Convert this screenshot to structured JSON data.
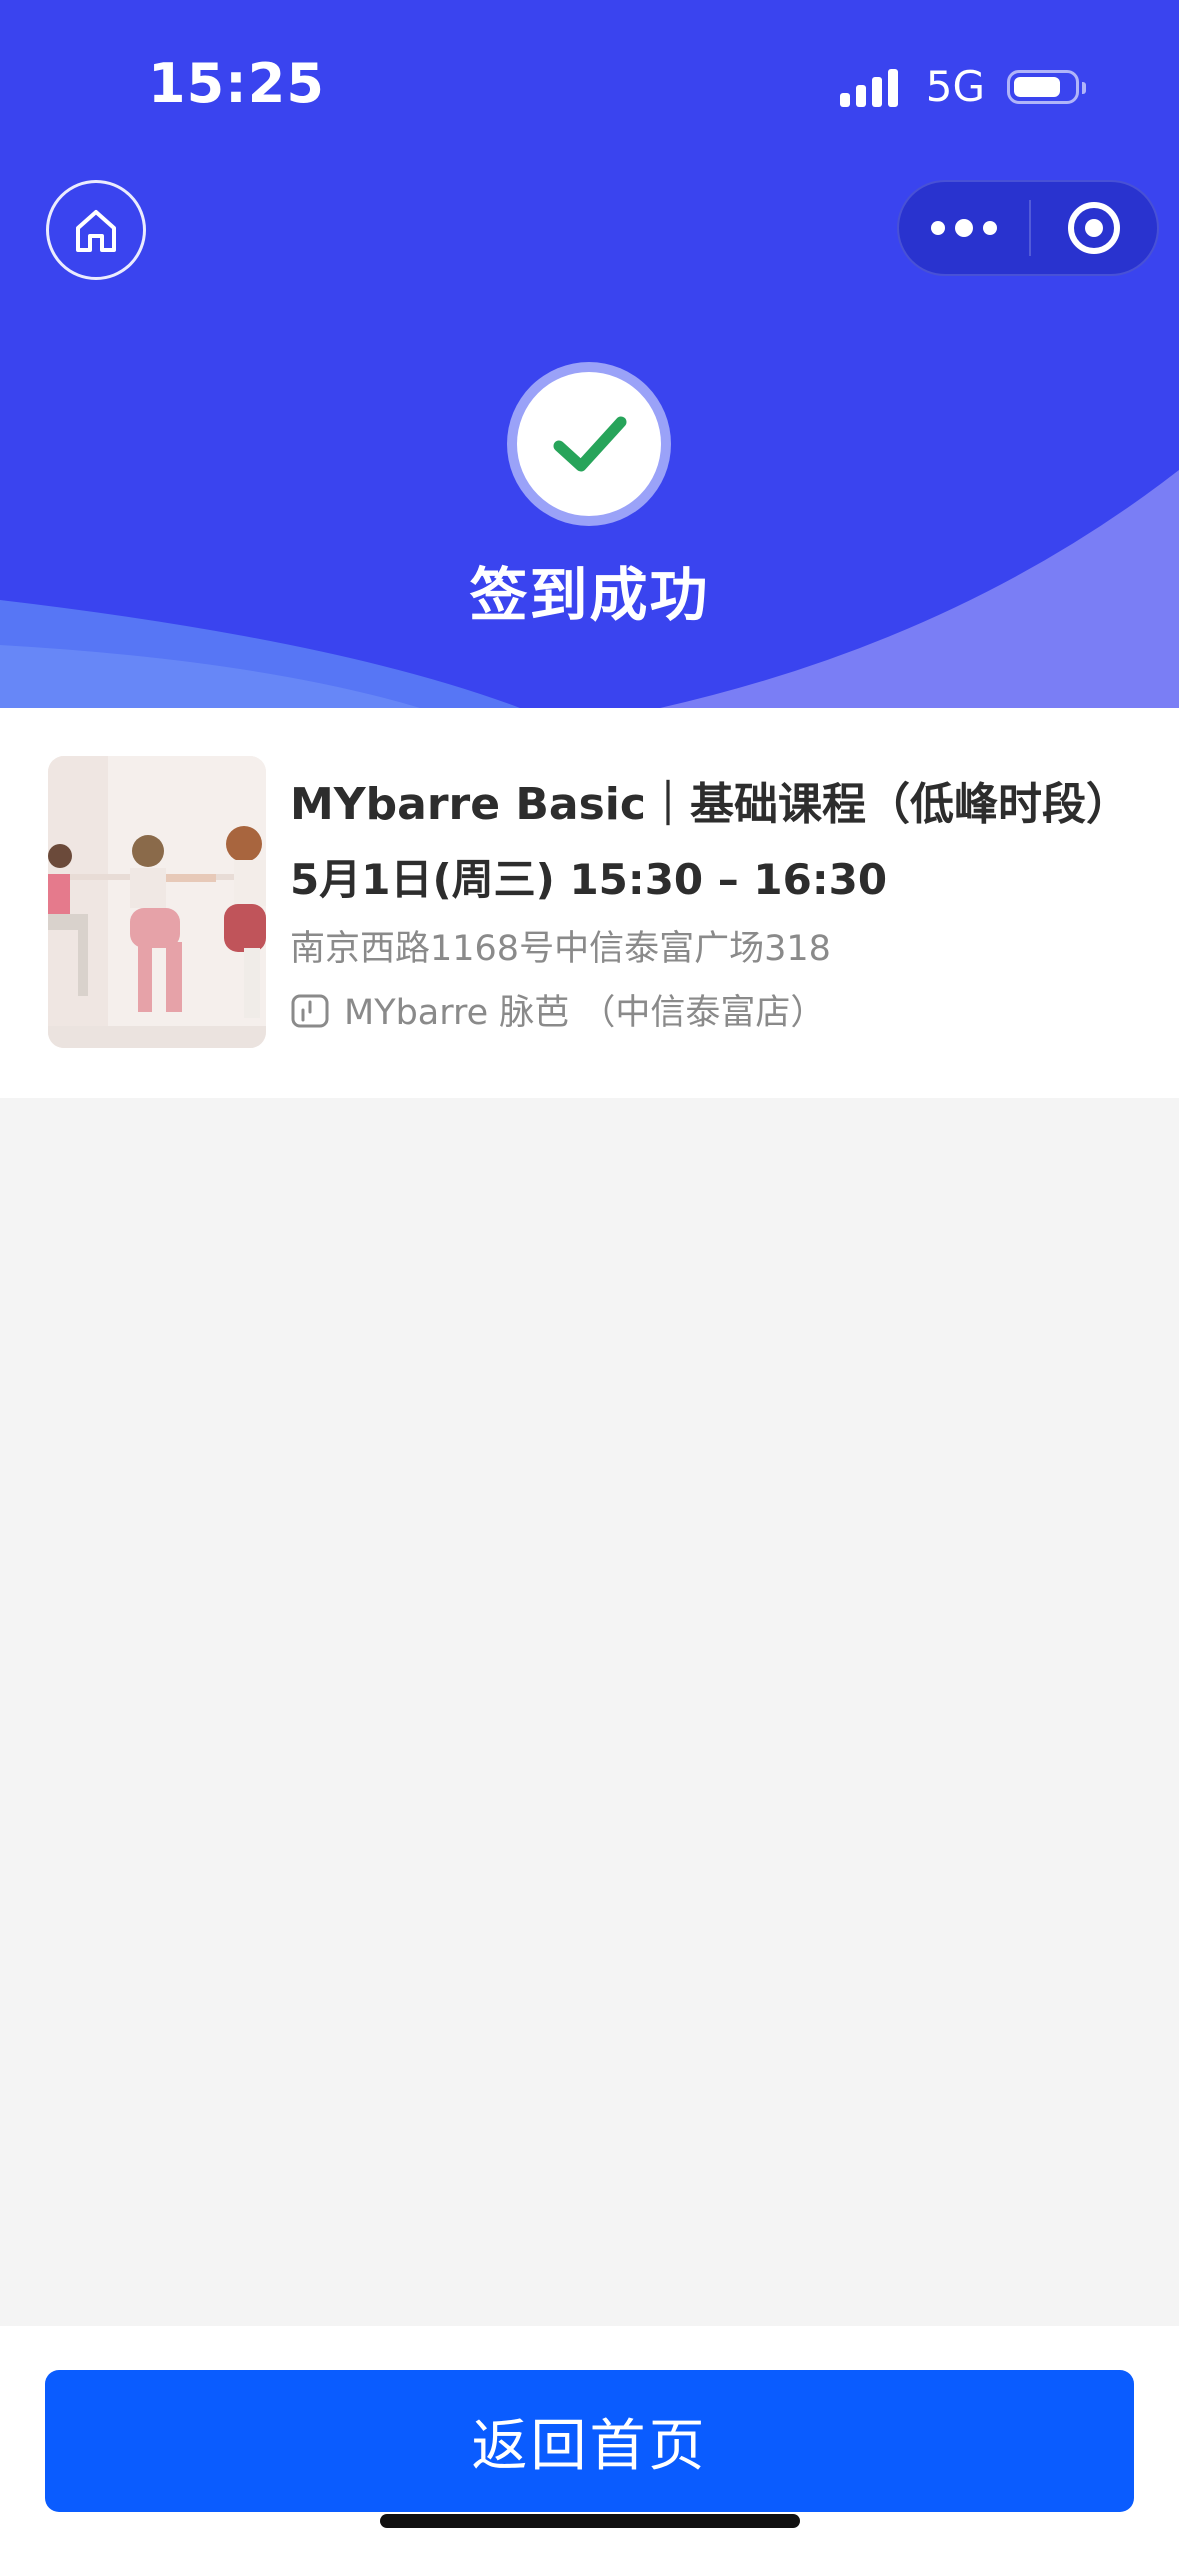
{
  "status_bar": {
    "time": "15:25",
    "network": "5G"
  },
  "header": {
    "home_icon": "home-icon",
    "capsule_more_icon": "more-dots-icon",
    "capsule_close_icon": "target-icon",
    "success_icon": "checkmark-icon",
    "success_title": "签到成功",
    "colors": {
      "background": "#3a44ef",
      "check": "#27a45a"
    }
  },
  "course": {
    "name": "MYbarre Basic｜基础课程（低峰时段）",
    "time": "5月1日(周三) 15:30 – 16:30",
    "address": "南京西路1168号中信泰富广场318",
    "store_icon": "store-icon",
    "store_name": "MYbarre 脉芭 （中信泰富店）"
  },
  "bottom": {
    "back_home_label": "返回首页",
    "button_color": "#0a5cff"
  }
}
